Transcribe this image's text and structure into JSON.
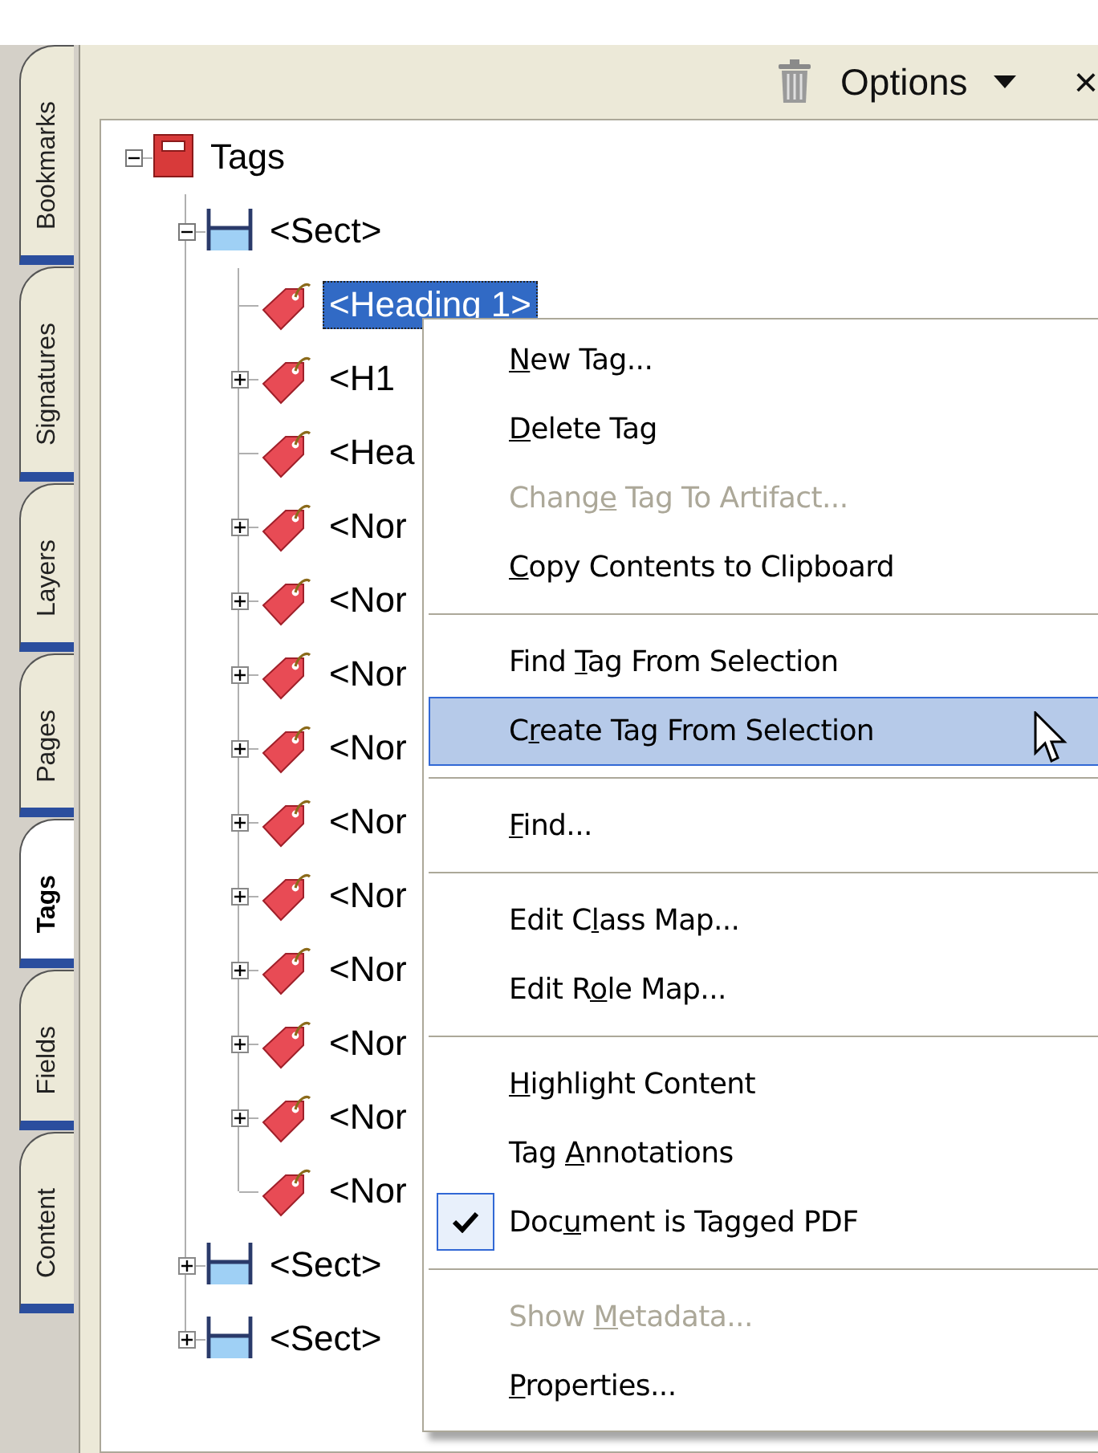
{
  "side_tabs": [
    {
      "label": "Bookmarks",
      "selected": false
    },
    {
      "label": "Signatures",
      "selected": false
    },
    {
      "label": "Layers",
      "selected": false
    },
    {
      "label": "Pages",
      "selected": false
    },
    {
      "label": "Tags",
      "selected": true
    },
    {
      "label": "Fields",
      "selected": false
    },
    {
      "label": "Content",
      "selected": false
    }
  ],
  "toolbar": {
    "options": "Options",
    "close": "×"
  },
  "tree": [
    {
      "kind": "root",
      "label": "Tags",
      "expanded": true,
      "selected": false,
      "children": [
        {
          "kind": "section",
          "label": "<Sect>",
          "expanded": true,
          "selected": false,
          "children": [
            {
              "kind": "tag",
              "label": "<Heading 1>",
              "selected": true
            },
            {
              "kind": "tag",
              "label": "<H1",
              "expanded": false,
              "selected": false
            },
            {
              "kind": "tag",
              "label": "<Hea",
              "selected": false
            },
            {
              "kind": "tag",
              "label": "<Nor",
              "expanded": false,
              "selected": false
            },
            {
              "kind": "tag",
              "label": "<Nor",
              "expanded": false,
              "selected": false
            },
            {
              "kind": "tag",
              "label": "<Nor",
              "expanded": false,
              "selected": false
            },
            {
              "kind": "tag",
              "label": "<Nor",
              "expanded": false,
              "selected": false
            },
            {
              "kind": "tag",
              "label": "<Nor",
              "expanded": false,
              "selected": false
            },
            {
              "kind": "tag",
              "label": "<Nor",
              "expanded": false,
              "selected": false
            },
            {
              "kind": "tag",
              "label": "<Nor",
              "expanded": false,
              "selected": false
            },
            {
              "kind": "tag",
              "label": "<Nor",
              "expanded": false,
              "selected": false
            },
            {
              "kind": "tag",
              "label": "<Nor",
              "expanded": false,
              "selected": false
            },
            {
              "kind": "tag",
              "label": "<Nor",
              "selected": false
            }
          ]
        },
        {
          "kind": "section",
          "label": "<Sect>",
          "expanded": false,
          "selected": false
        },
        {
          "kind": "section",
          "label": "<Sect>",
          "expanded": false,
          "selected": false
        }
      ]
    }
  ],
  "context_menu": {
    "groups": [
      {
        "items": [
          {
            "key": "N",
            "after": "ew Tag...",
            "disabled": false,
            "selected": false,
            "checked": false
          },
          {
            "key": "D",
            "after": "elete Tag",
            "disabled": false,
            "selected": false,
            "checked": false
          },
          {
            "before": "Chang",
            "key": "e",
            "after": " Tag To Artifact...",
            "disabled": true,
            "selected": false,
            "checked": false
          },
          {
            "key": "C",
            "after": "opy Contents to Clipboard",
            "disabled": false,
            "selected": false,
            "checked": false
          }
        ]
      },
      {
        "items": [
          {
            "before": "Find ",
            "key": "T",
            "after": "ag From Selection",
            "disabled": false,
            "selected": false,
            "checked": false
          },
          {
            "before": "C",
            "key": "r",
            "after": "eate Tag From Selection",
            "disabled": false,
            "selected": true,
            "checked": false
          }
        ]
      },
      {
        "items": [
          {
            "key": "F",
            "after": "ind...",
            "disabled": false,
            "selected": false,
            "checked": false
          }
        ]
      },
      {
        "items": [
          {
            "before": "Edit C",
            "key": "l",
            "after": "ass Map...",
            "disabled": false,
            "selected": false,
            "checked": false
          },
          {
            "before": "Edit R",
            "key": "o",
            "after": "le Map...",
            "disabled": false,
            "selected": false,
            "checked": false
          }
        ]
      },
      {
        "items": [
          {
            "key": "H",
            "after": "ighlight Content",
            "disabled": false,
            "selected": false,
            "checked": false
          },
          {
            "before": "Tag ",
            "key": "A",
            "after": "nnotations",
            "disabled": false,
            "selected": false,
            "checked": false
          },
          {
            "before": "Doc",
            "key": "u",
            "after": "ment is Tagged PDF",
            "disabled": false,
            "selected": false,
            "checked": true
          }
        ]
      },
      {
        "items": [
          {
            "before": "Show ",
            "key": "M",
            "after": "etadata...",
            "disabled": true,
            "selected": false,
            "checked": false
          },
          {
            "key": "P",
            "after": "roperties...",
            "disabled": false,
            "selected": false,
            "checked": false
          }
        ]
      }
    ]
  }
}
